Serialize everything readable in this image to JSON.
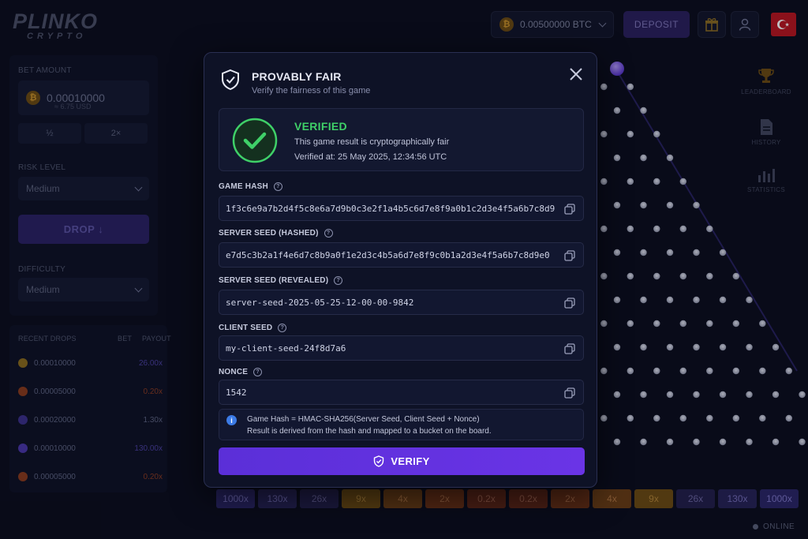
{
  "app": {
    "logo_main": "PLINKO",
    "logo_sub": "CRYPTO"
  },
  "topbar": {
    "balance": "0.00500000 BTC",
    "coin_glyph": "₿",
    "deposit_label": "DEPOSIT"
  },
  "left_panel": {
    "bet_amount_label": "BET AMOUNT",
    "bet_amount_value": "0.00010000",
    "bet_amount_usd": "≈ 6.75 USD",
    "half_label": "½",
    "double_label": "2×",
    "risk_label": "RISK LEVEL",
    "risk_value": "Medium",
    "drop_label": "DROP ↓",
    "difficulty_label": "DIFFICULTY",
    "difficulty_value": "Medium"
  },
  "recent": {
    "title": "RECENT DROPS",
    "col_bet": "BET",
    "col_payout": "PAYOUT",
    "rows": [
      {
        "bet": "0.00010000",
        "payout": "26.00x",
        "ball": "#8a6a1c",
        "pay_color": "#4b3fa0"
      },
      {
        "bet": "0.00005000",
        "payout": "0.20x",
        "ball": "#8a3a1c",
        "pay_color": "#8a3a22"
      },
      {
        "bet": "0.00020000",
        "payout": "1.30x",
        "ball": "#3b2f8a",
        "pay_color": "#5d6280"
      },
      {
        "bet": "0.00010000",
        "payout": "130.00x",
        "ball": "#4a36a8",
        "pay_color": "#4b3fa0"
      },
      {
        "bet": "0.00005000",
        "payout": "0.20x",
        "ball": "#8a3a1c",
        "pay_color": "#8a3a22"
      }
    ]
  },
  "right_nav": {
    "leaderboard": "LEADERBOARD",
    "history": "HISTORY",
    "statistics": "STATISTICS"
  },
  "status": {
    "online": "ONLINE"
  },
  "buckets": [
    {
      "label": "1000x",
      "bg": "#2a2566",
      "fg": "#7b73c4"
    },
    {
      "label": "130x",
      "bg": "#262256",
      "fg": "#736bb6"
    },
    {
      "label": "26x",
      "bg": "#221e4a",
      "fg": "#6a639f"
    },
    {
      "label": "9x",
      "bg": "#6b4a12",
      "fg": "#b08236"
    },
    {
      "label": "4x",
      "bg": "#6a3c14",
      "fg": "#b07440"
    },
    {
      "label": "2x",
      "bg": "#682f14",
      "fg": "#aa6a44"
    },
    {
      "label": "0.2x",
      "bg": "#5d2416",
      "fg": "#a2624c"
    },
    {
      "label": "0.2x",
      "bg": "#5d2416",
      "fg": "#a2624c"
    },
    {
      "label": "2x",
      "bg": "#682f14",
      "fg": "#aa6a44"
    },
    {
      "label": "4x",
      "bg": "#6a3c14",
      "fg": "#b07440"
    },
    {
      "label": "9x",
      "bg": "#6b4a12",
      "fg": "#b08236"
    },
    {
      "label": "26x",
      "bg": "#221e4a",
      "fg": "#6a639f"
    },
    {
      "label": "130x",
      "bg": "#262256",
      "fg": "#736bb6"
    },
    {
      "label": "1000x",
      "bg": "#2a2566",
      "fg": "#7b73c4"
    }
  ],
  "modal": {
    "title": "PROVABLY FAIR",
    "subtitle": "Verify the fairness of this game",
    "verified_title": "VERIFIED",
    "verified_desc": "This game result is cryptographically fair",
    "verified_time": "Verified at: 25 May 2025, 12:34:56 UTC",
    "fields": [
      {
        "label": "GAME HASH",
        "value": "1f3c6e9a7b2d4f5c8e6a7d9b0c3e2f1a4b5c6d7e8f9a0b1c2d3e4f5a6b7c8d9"
      },
      {
        "label": "SERVER SEED (HASHED)",
        "value": "e7d5c3b2a1f4e6d7c8b9a0f1e2d3c4b5a6d7e8f9c0b1a2d3e4f5a6b7c8d9e0"
      },
      {
        "label": "SERVER SEED (REVEALED)",
        "value": "server-seed-2025-05-25-12-00-00-9842"
      },
      {
        "label": "CLIENT SEED",
        "value": "my-client-seed-24f8d7a6"
      },
      {
        "label": "NONCE",
        "value": "1542"
      }
    ],
    "info_line1": "Game Hash = HMAC-SHA256(Server Seed, Client Seed + Nonce)",
    "info_line2": "Result is derived from the hash and mapped to a bucket on the board.",
    "verify_label": "VERIFY"
  },
  "colors": {
    "accent": "#6a34e6",
    "verified": "#3fd068",
    "info": "#3c7be6"
  }
}
